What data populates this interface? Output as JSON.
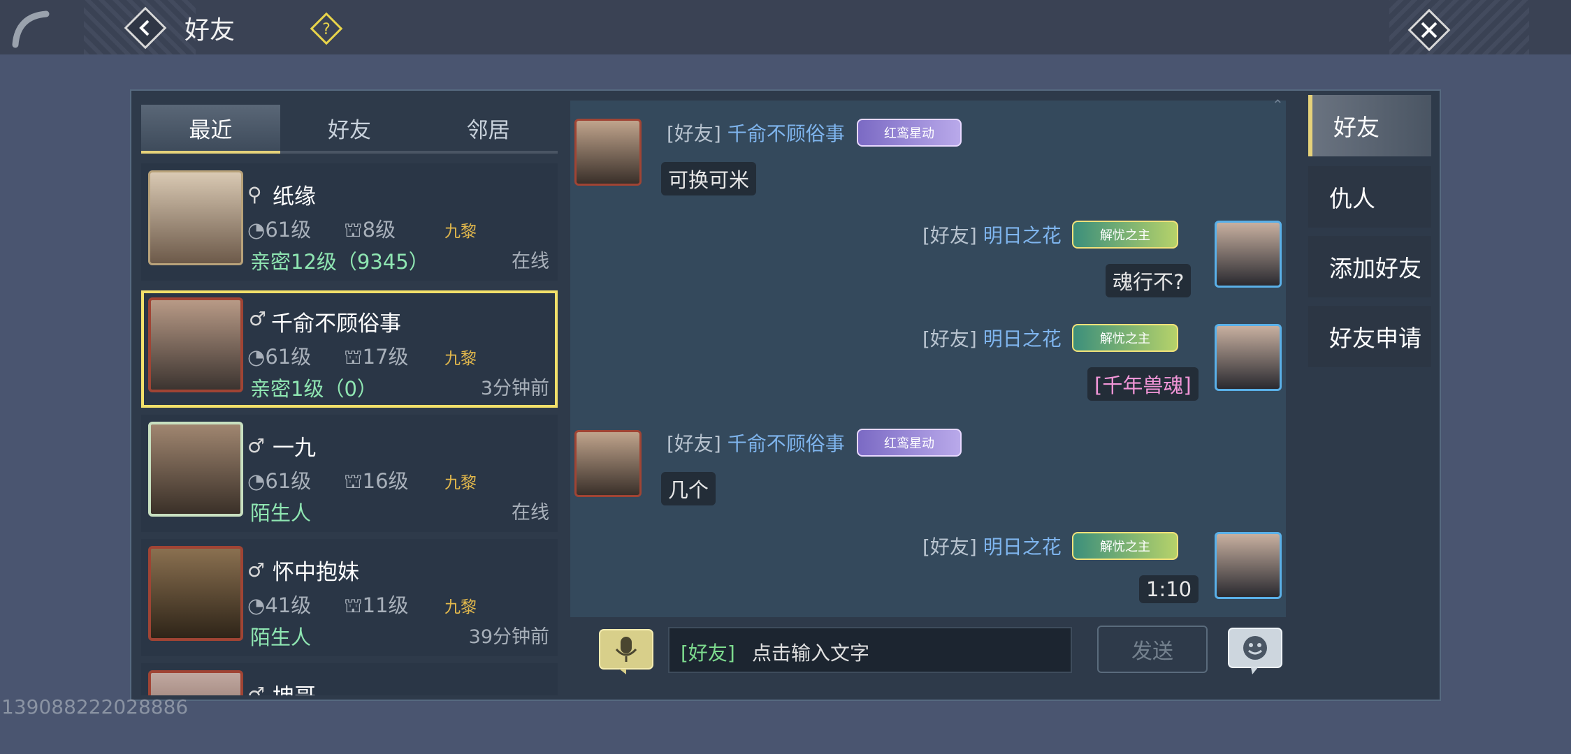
{
  "header": {
    "title": "好友",
    "help_glyph": "?"
  },
  "list_tabs": [
    {
      "label": "最近",
      "active": true
    },
    {
      "label": "好友",
      "active": false
    },
    {
      "label": "邻居",
      "active": false
    }
  ],
  "friends": [
    {
      "name": "纸缘",
      "gender_icon": "search-icon",
      "level": "61级",
      "house_level": "8级",
      "guild": "九黎",
      "intimacy": "亲密12级（9345）",
      "status": "在线",
      "selected": false
    },
    {
      "name": "千俞不顾俗事",
      "gender_icon": "male-icon",
      "level": "61级",
      "house_level": "17级",
      "guild": "九黎",
      "intimacy": "亲密1级（0）",
      "status": "3分钟前",
      "selected": true
    },
    {
      "name": "一九",
      "gender_icon": "male-icon",
      "level": "61级",
      "house_level": "16级",
      "guild": "九黎",
      "intimacy": "陌生人",
      "status": "在线",
      "selected": false
    },
    {
      "name": "怀中抱妹",
      "gender_icon": "male-icon",
      "level": "41级",
      "house_level": "11级",
      "guild": "九黎",
      "intimacy": "陌生人",
      "status": "39分钟前",
      "selected": false
    },
    {
      "name": "坤哥",
      "gender_icon": "male-icon",
      "level": "",
      "house_level": "",
      "guild": "",
      "intimacy": "",
      "status": "",
      "selected": false
    }
  ],
  "messages": [
    {
      "side": "left",
      "channel": "[好友]",
      "sender": "千俞不顾俗事",
      "badge": "红鸾星动",
      "text": "可换可米"
    },
    {
      "side": "right",
      "channel": "[好友]",
      "sender": "明日之花",
      "badge": "解忧之主",
      "text": "魂行不?"
    },
    {
      "side": "right",
      "channel": "[好友]",
      "sender": "明日之花",
      "badge": "解忧之主",
      "text": "[千年兽魂]"
    },
    {
      "side": "left",
      "channel": "[好友]",
      "sender": "千俞不顾俗事",
      "badge": "红鸾星动",
      "text": "几个"
    },
    {
      "side": "right",
      "channel": "[好友]",
      "sender": "明日之花",
      "badge": "解忧之主",
      "text": "1:10"
    }
  ],
  "input": {
    "channel": "[好友]",
    "placeholder": "点击输入文字",
    "send_label": "发送"
  },
  "right_tabs": [
    {
      "label": "好友",
      "active": true
    },
    {
      "label": "仇人",
      "active": false
    },
    {
      "label": "添加好友",
      "active": false
    },
    {
      "label": "好友申请",
      "active": false
    }
  ],
  "watermark": "139088222028886",
  "colors": {
    "accent_gold": "#f2e06a",
    "sender_blue": "#7fb5ee",
    "intimacy_green": "#8fe6b2",
    "item_pink": "#f296d8"
  }
}
